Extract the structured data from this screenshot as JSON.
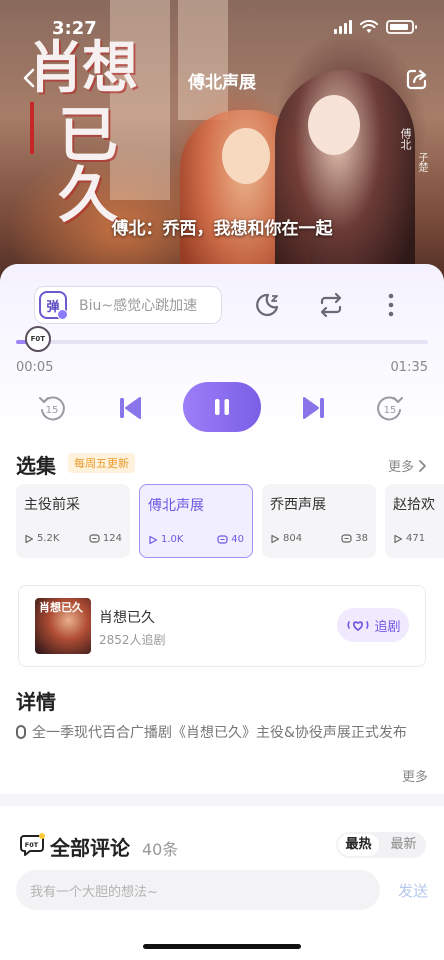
{
  "status_bar": {
    "time": "3:27"
  },
  "nav": {
    "title": "傅北声展"
  },
  "cover": {
    "logo_line1": "肖想",
    "logo_line2": "已久",
    "signature": "傅北",
    "signature2": "子楚",
    "subtitle": "傅北：乔西，我想和你在一起"
  },
  "player": {
    "danmu_badge": "弹",
    "danmu_placeholder": "Biu~感觉心跳加速",
    "current_time": "00:05",
    "duration": "01:35",
    "progress": 0.053,
    "knob_text": "F0T",
    "rewind_label": "15",
    "forward_label": "15"
  },
  "episodes": {
    "title": "选集",
    "badge": "每周五更新",
    "more": "更多",
    "items": [
      {
        "name": "主役前采",
        "plays": "5.2K",
        "comments": "124",
        "active": false
      },
      {
        "name": "傅北声展",
        "plays": "1.0K",
        "comments": "40",
        "active": true
      },
      {
        "name": "乔西声展",
        "plays": "804",
        "comments": "38",
        "active": false
      },
      {
        "name": "赵拾欢",
        "plays": "471",
        "comments": "",
        "active": false
      }
    ]
  },
  "drama": {
    "cover_text": "肖想已久",
    "name": "肖想已久",
    "followers": "2852人追剧",
    "follow_button": "追剧"
  },
  "details": {
    "title": "详情",
    "text": "全一季现代百合广播剧《肖想已久》主役&协役声展正式发布",
    "more": "更多"
  },
  "comments": {
    "title": "全部评论",
    "count": "40条",
    "sort_hot": "最热",
    "sort_new": "最新",
    "input_placeholder": "我有一个大胆的想法~",
    "send": "发送"
  },
  "colors": {
    "accent": "#7a5fe6",
    "accent_light": "#f1eeff",
    "badge_bg": "#fff2dc",
    "badge_text": "#e89a2a"
  }
}
